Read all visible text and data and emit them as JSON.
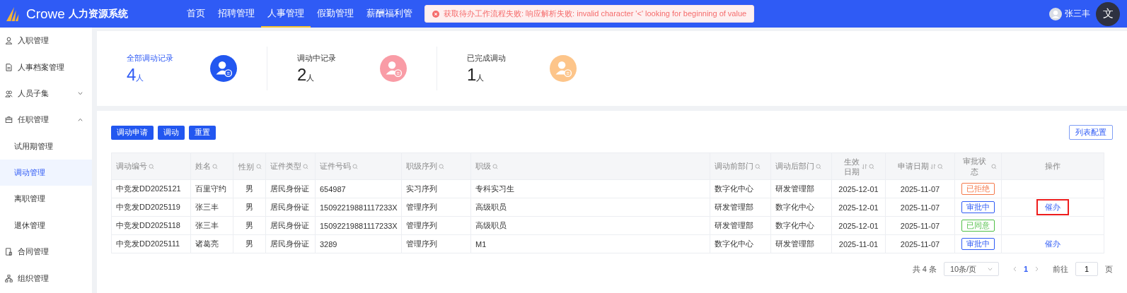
{
  "header": {
    "brand": "Crowe",
    "system": "人力资源系统",
    "nav": [
      {
        "label": "首页",
        "selected": false
      },
      {
        "label": "招聘管理",
        "selected": false
      },
      {
        "label": "人事管理",
        "selected": true
      },
      {
        "label": "假勤管理",
        "selected": false
      },
      {
        "label": "薪酬福利管",
        "selected": false
      }
    ],
    "user": "张三丰",
    "translate_button": "文"
  },
  "toast": {
    "message": "获取待办工作流程失败: 响应解析失败: invalid character '<' looking for beginning of value"
  },
  "sidebar": {
    "items": [
      {
        "label": "入职管理",
        "selected": false
      },
      {
        "label": "人事档案管理",
        "selected": false
      },
      {
        "label": "人员子集",
        "expanded": false,
        "selected": false
      },
      {
        "label": "任职管理",
        "expanded": true,
        "selected": false,
        "children": [
          {
            "label": "试用期管理",
            "selected": false
          },
          {
            "label": "调动管理",
            "selected": true
          },
          {
            "label": "离职管理",
            "selected": false
          },
          {
            "label": "退休管理",
            "selected": false
          }
        ]
      },
      {
        "label": "合同管理",
        "selected": false
      },
      {
        "label": "组织管理",
        "selected": false
      }
    ]
  },
  "stats": [
    {
      "label": "全部调动记录",
      "value": "4",
      "unit": "人",
      "selected": true,
      "color": "#2257f0"
    },
    {
      "label": "调动中记录",
      "value": "2",
      "unit": "人",
      "selected": false,
      "color": "#f99ca6"
    },
    {
      "label": "已完成调动",
      "value": "1",
      "unit": "人",
      "selected": false,
      "color": "#fdc58a"
    }
  ],
  "toolbar": {
    "buttons": [
      "调动申请",
      "调动",
      "重置"
    ],
    "config_button": "列表配置"
  },
  "table": {
    "columns": [
      {
        "label": "调动编号",
        "filterable": true,
        "sortable": false
      },
      {
        "label": "姓名",
        "filterable": true,
        "sortable": false
      },
      {
        "label": "性别",
        "filterable": true,
        "sortable": false
      },
      {
        "label": "证件类型",
        "filterable": true,
        "sortable": false
      },
      {
        "label": "证件号码",
        "filterable": true,
        "sortable": false
      },
      {
        "label": "职级序列",
        "filterable": true,
        "sortable": false
      },
      {
        "label": "职级",
        "filterable": true,
        "sortable": false
      },
      {
        "label": "调动前部门",
        "filterable": true,
        "sortable": false
      },
      {
        "label": "调动后部门",
        "filterable": true,
        "sortable": false
      },
      {
        "label": "生效日期",
        "filterable": true,
        "sortable": true
      },
      {
        "label": "申请日期",
        "filterable": true,
        "sortable": true
      },
      {
        "label": "审批状态",
        "filterable": true,
        "sortable": false
      },
      {
        "label": "操作",
        "filterable": false,
        "sortable": false
      }
    ],
    "rows": [
      {
        "cells": [
          "中竞发DD2025121",
          "百里守约",
          "男",
          "居民身份证",
          "654987",
          "实习序列",
          "专科实习生",
          "数字化中心",
          "研发管理部",
          "2025-12-01",
          "2025-11-07"
        ],
        "status": {
          "label": "已拒绝",
          "color": "#f5794a"
        }
      },
      {
        "cells": [
          "中竞发DD2025119",
          "张三丰",
          "男",
          "居民身份证",
          "15092219881117233X",
          "管理序列",
          "高级职员",
          "研发管理部",
          "数字化中心",
          "2025-12-01",
          "2025-11-07"
        ],
        "status": {
          "label": "审批中",
          "color": "#2f5bf5"
        },
        "action": {
          "label": "催办",
          "highlighted": true
        }
      },
      {
        "cells": [
          "中竞发DD2025118",
          "张三丰",
          "男",
          "居民身份证",
          "15092219881117233X",
          "管理序列",
          "高级职员",
          "研发管理部",
          "数字化中心",
          "2025-12-01",
          "2025-11-07"
        ],
        "status": {
          "label": "已同意",
          "color": "#4fbf46"
        }
      },
      {
        "cells": [
          "中竞发DD2025111",
          "诸葛亮",
          "男",
          "居民身份证",
          "3289",
          "管理序列",
          "M1",
          "数字化中心",
          "研发管理部",
          "2025-11-01",
          "2025-11-07"
        ],
        "status": {
          "label": "审批中",
          "color": "#2f5bf5"
        },
        "action": {
          "label": "催办",
          "highlighted": false
        }
      }
    ]
  },
  "pagination": {
    "total": "共 4 条",
    "page_size": "10条/页",
    "pages": [
      {
        "label": "1",
        "selected": true
      }
    ],
    "goto_label": "前往",
    "goto_value": "1",
    "goto_suffix": "页"
  }
}
